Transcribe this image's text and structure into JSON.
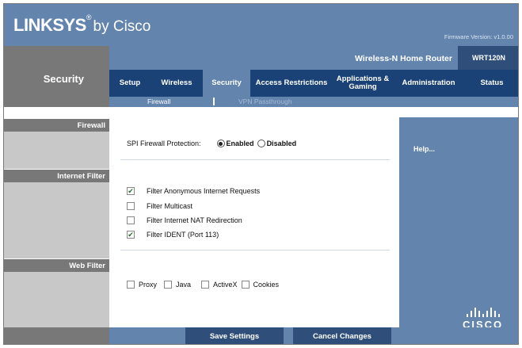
{
  "header": {
    "brand": "LINKSYS",
    "brand_suffix": "by Cisco",
    "firmware": "Firmware Version: v1.0.00"
  },
  "product": {
    "name": "Wireless-N Home Router",
    "model": "WRT120N"
  },
  "page": {
    "section_title": "Security"
  },
  "tabs": [
    {
      "label": "Setup"
    },
    {
      "label": "Wireless"
    },
    {
      "label": "Security"
    },
    {
      "label": "Access Restrictions"
    },
    {
      "label": "Applications & Gaming"
    },
    {
      "label": "Administration"
    },
    {
      "label": "Status"
    }
  ],
  "subtabs": [
    {
      "label": "Firewall"
    },
    {
      "label": "VPN Passthrough"
    }
  ],
  "left_sections": {
    "firewall": "Firewall",
    "internet_filter": "Internet Filter",
    "web_filter": "Web Filter"
  },
  "firewall": {
    "spi_label": "SPI Firewall Protection:",
    "enabled_label": "Enabled",
    "disabled_label": "Disabled",
    "selected": "Enabled"
  },
  "internet_filter": [
    {
      "label": "Filter Anonymous Internet Requests",
      "checked": true
    },
    {
      "label": "Filter Multicast",
      "checked": false
    },
    {
      "label": "Filter Internet NAT Redirection",
      "checked": false
    },
    {
      "label": "Filter IDENT (Port 113)",
      "checked": true
    }
  ],
  "web_filter": [
    {
      "label": "Proxy",
      "checked": false
    },
    {
      "label": "Java",
      "checked": false
    },
    {
      "label": "ActiveX",
      "checked": false
    },
    {
      "label": "Cookies",
      "checked": false
    }
  ],
  "help": {
    "link": "Help..."
  },
  "footer": {
    "save_label": "Save Settings",
    "cancel_label": "Cancel Changes"
  },
  "cisco_logo": "CISCO",
  "colors": {
    "header_blue": "#6284ad",
    "nav_dark_blue": "#1a4276",
    "left_gray": "#787878",
    "left_light_gray": "#c8c8c8"
  }
}
